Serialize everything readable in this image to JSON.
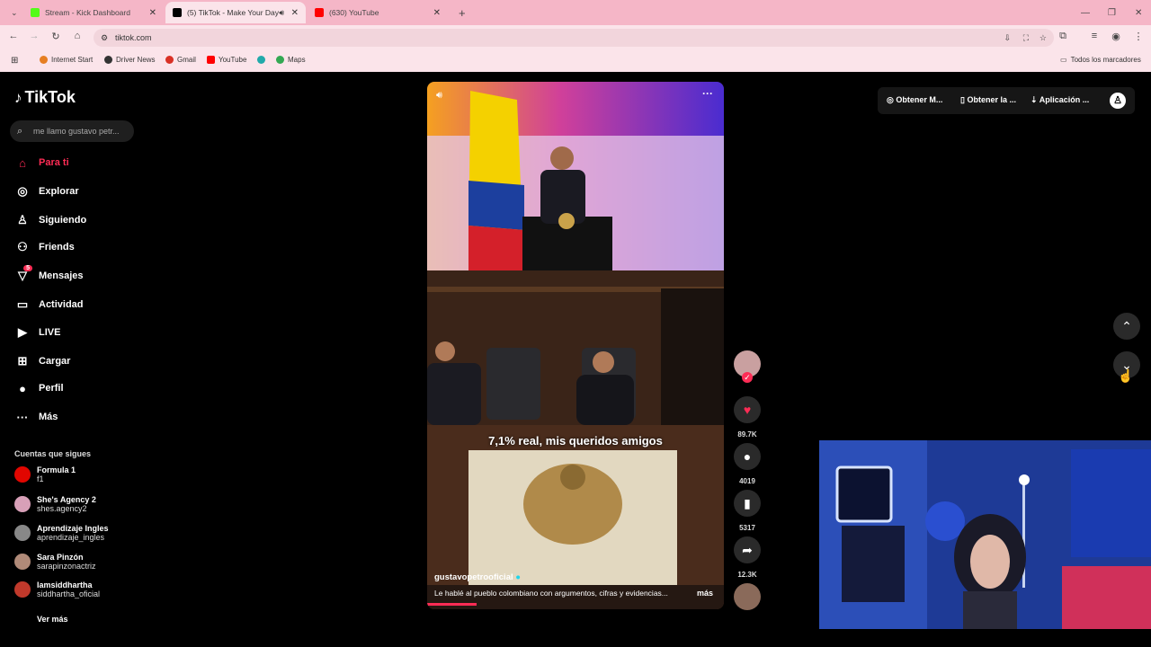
{
  "browser": {
    "tabs": [
      {
        "title": "Stream - Kick Dashboard",
        "color": "#53fc18"
      },
      {
        "title": "(5) TikTok - Make Your Day",
        "color": "#000000"
      },
      {
        "title": "(630) YouTube",
        "color": "#ff0000"
      }
    ],
    "url": "tiktok.com",
    "bookmarks": [
      "Internet Start",
      "Driver News",
      "Gmail",
      "YouTube",
      "Maps"
    ],
    "all_bookmarks": "Todos los marcadores"
  },
  "tiktok": {
    "logo": "TikTok",
    "search_placeholder": "me llamo gustavo petr...",
    "nav": [
      {
        "label": "Para ti",
        "icon": "home-icon",
        "glyph": "⌂"
      },
      {
        "label": "Explorar",
        "icon": "compass-icon",
        "glyph": "◎"
      },
      {
        "label": "Siguiendo",
        "icon": "following-icon",
        "glyph": "♙"
      },
      {
        "label": "Friends",
        "icon": "friends-icon",
        "glyph": "⚇"
      },
      {
        "label": "Mensajes",
        "icon": "messages-icon",
        "glyph": "▽",
        "badge": "5"
      },
      {
        "label": "Actividad",
        "icon": "activity-icon",
        "glyph": "▭"
      },
      {
        "label": "LIVE",
        "icon": "live-icon",
        "glyph": "▶"
      },
      {
        "label": "Cargar",
        "icon": "upload-icon",
        "glyph": "⊞"
      },
      {
        "label": "Perfil",
        "icon": "profile-icon",
        "glyph": "●"
      },
      {
        "label": "Más",
        "icon": "more-icon",
        "glyph": "···"
      }
    ],
    "following_title": "Cuentas que sigues",
    "following": [
      {
        "name": "Formula 1",
        "handle": "f1",
        "color": "#e10600"
      },
      {
        "name": "She's Agency 2",
        "handle": "shes.agency2",
        "color": "#d8a0b8"
      },
      {
        "name": "Aprendizaje Ingles",
        "handle": "aprendizaje_ingles",
        "color": "#888888"
      },
      {
        "name": "Sara Pinzón",
        "handle": "sarapinzonactriz",
        "color": "#b08a78"
      },
      {
        "name": "Iamsiddhartha",
        "handle": "siddhartha_oficial",
        "color": "#c0392b"
      }
    ],
    "see_more": "Ver más",
    "video": {
      "caption": "7,1% real, mis queridos amigos",
      "username": "gustavopetrooficial",
      "description": "Le hablé al pueblo colombiano con argumentos, cifras y evidencias...",
      "more": "más"
    },
    "actions": {
      "likes": "89.7K",
      "comments": "4019",
      "saves": "5317",
      "shares": "12.3K"
    },
    "topbar": [
      "Obtener M...",
      "Obtener la ...",
      "Aplicación ..."
    ]
  }
}
